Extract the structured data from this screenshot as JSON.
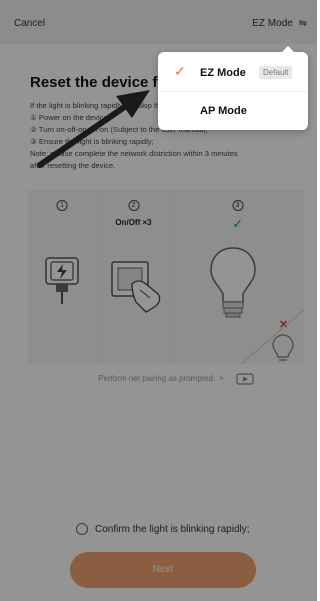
{
  "topbar": {
    "cancel_label": "Cancel",
    "mode_label": "EZ Mode",
    "mode_switch_glyph": "⇋"
  },
  "card": {
    "title": "Reset the device first.",
    "steps": [
      "If the light is blinking rapidly, pls skip the following steps.",
      "① Power on the device;",
      "② Turn on-off-on-off-on (Subject to the user manual);",
      "③ Ensure the light is blinking rapidly;",
      "Note: please complete the network distriction within 3 minutes",
      "after resetting the device."
    ],
    "illustration": {
      "step_numbers": [
        "1",
        "2",
        "3"
      ],
      "step2_caption": "On/Off ×3",
      "step3_check": "✓",
      "wrong_mark": "✕"
    },
    "prompt_text": "Perform net pairing as prompted.",
    "prompt_chevron": ">",
    "confirm_label": "Confirm the light is blinking rapidly;",
    "next_label": "Next"
  },
  "menu": {
    "items": [
      {
        "label": "EZ Mode",
        "selected": true,
        "badge": "Default"
      },
      {
        "label": "AP Mode",
        "selected": false
      }
    ]
  },
  "colors": {
    "accent": "#ff6a1f",
    "next_button": "#f0a070",
    "check": "#2eb872",
    "wrong": "#d83a3a"
  },
  "icons": [
    "mode-switch-icon",
    "check-icon",
    "plug-icon",
    "switch-icon",
    "bulb-icon",
    "video-icon",
    "radio-icon",
    "arrow-annotation"
  ]
}
